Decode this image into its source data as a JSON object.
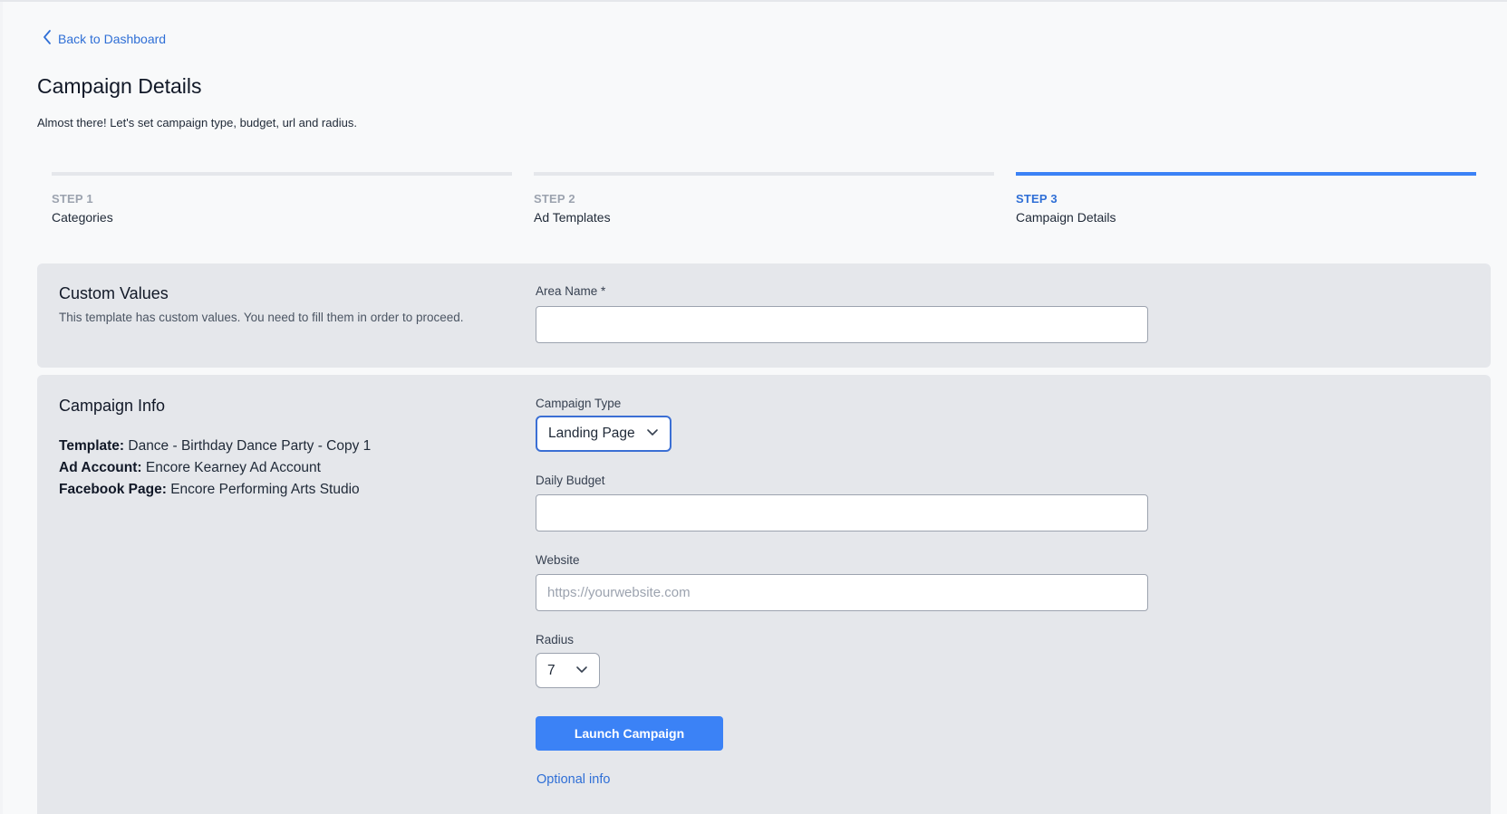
{
  "nav": {
    "back_label": "Back to Dashboard"
  },
  "header": {
    "title": "Campaign Details",
    "subtitle": "Almost there! Let's set campaign type, budget, url and radius."
  },
  "steps": [
    {
      "number": "STEP 1",
      "name": "Categories",
      "active": false
    },
    {
      "number": "STEP 2",
      "name": "Ad Templates",
      "active": false
    },
    {
      "number": "STEP 3",
      "name": "Campaign Details",
      "active": true
    }
  ],
  "custom_values": {
    "title": "Custom Values",
    "description": "This template has custom values. You need to fill them in order to proceed.",
    "area_name_label": "Area Name *",
    "area_name_value": ""
  },
  "campaign_info": {
    "title": "Campaign Info",
    "template_label": "Template:",
    "template_value": "Dance - Birthday Dance Party - Copy 1",
    "ad_account_label": "Ad Account:",
    "ad_account_value": "Encore Kearney Ad Account",
    "facebook_page_label": "Facebook Page:",
    "facebook_page_value": "Encore Performing Arts Studio"
  },
  "form": {
    "campaign_type_label": "Campaign Type",
    "campaign_type_value": "Landing Page",
    "daily_budget_label": "Daily Budget",
    "daily_budget_value": "",
    "website_label": "Website",
    "website_placeholder": "https://yourwebsite.com",
    "radius_label": "Radius",
    "radius_value": "7",
    "launch_label": "Launch Campaign",
    "optional_label": "Optional info"
  },
  "colors": {
    "accent": "#3b82f6",
    "link": "#2f6fd6",
    "card_bg": "#e5e7eb",
    "page_bg": "#f8f9fa"
  },
  "icons": {
    "back": "chevron-left-icon",
    "dropdown": "chevron-down-icon"
  }
}
